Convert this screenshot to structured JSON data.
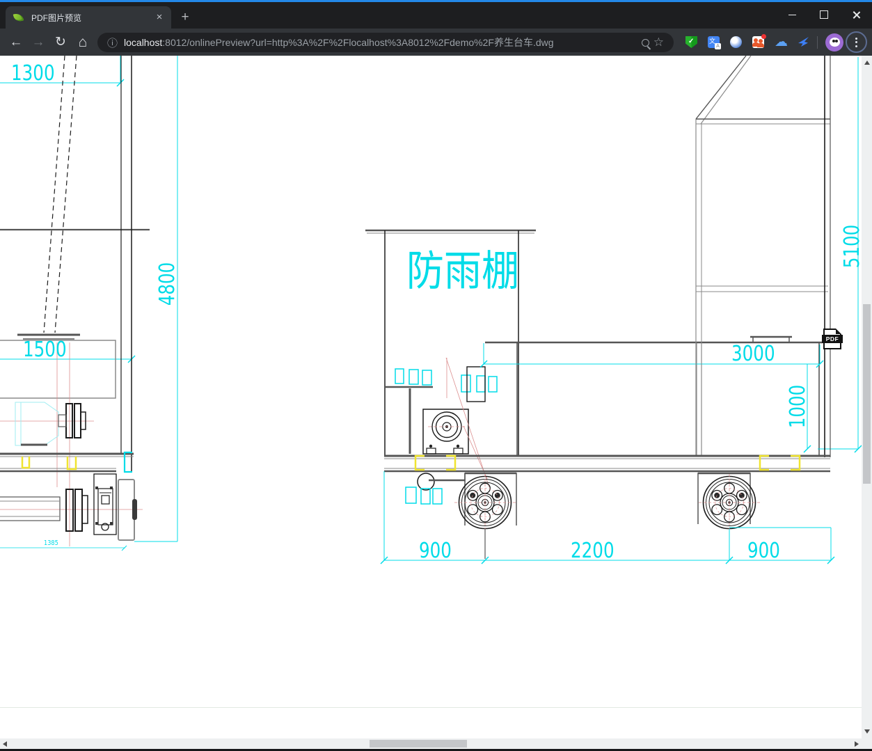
{
  "browser": {
    "tab_title": "PDF图片预览",
    "url_host": "localhost",
    "url_rest": ":8012/onlinePreview?url=http%3A%2F%2Flocalhost%3A8012%2Fdemo%2F养生台车.dwg",
    "icons": {
      "back": "←",
      "forward": "→",
      "reload": "↻",
      "home": "⌂",
      "info": "ⓘ",
      "bookmark_star": "☆",
      "close_tab": "×",
      "new_tab": "+",
      "cloud": "☁",
      "translate_cn": "文",
      "translate_a": "A",
      "shield_check": "✓",
      "extension_names": [
        "shield-extension",
        "translate-extension",
        "sphere-extension",
        "contacts-extension",
        "cloud-extension",
        "bird-extension"
      ]
    }
  },
  "drawing": {
    "shelter_label": "防雨棚",
    "pdf_badge": "PDF",
    "colors": {
      "dimension": "#00dce8",
      "highlight": "#f0e430",
      "centerline": "#dc8f8f"
    },
    "dims": {
      "left_top": "1300",
      "left_mid": "1500",
      "left_height": "4800",
      "left_small": "1385",
      "deck_top": "3000",
      "deck_height": "1000",
      "right_height": "5100",
      "wheel_left": "900",
      "wheel_span": "2200",
      "wheel_right": "900"
    }
  }
}
